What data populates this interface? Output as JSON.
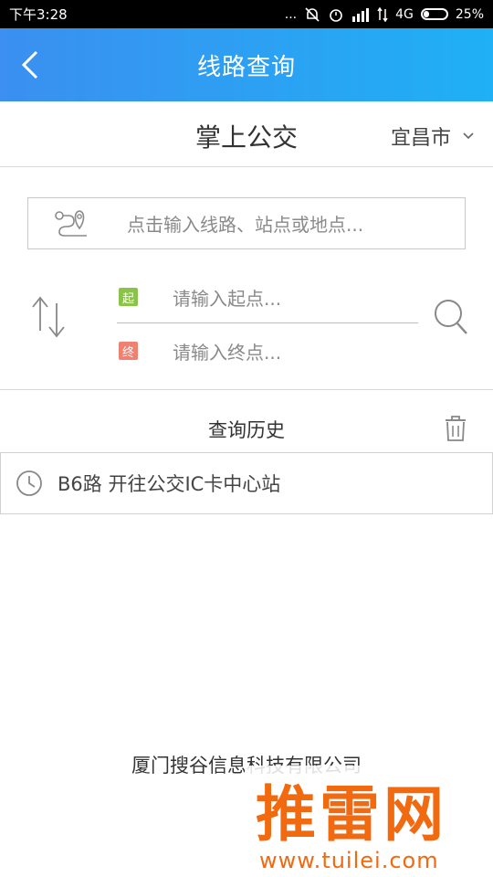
{
  "status_bar": {
    "time": "下午3:28",
    "signal_dots": "...",
    "network": "4G",
    "battery": "25%",
    "battery_level": 0.25
  },
  "topbar": {
    "title": "线路查询"
  },
  "brand": {
    "title": "掌上公交",
    "city": "宜昌市"
  },
  "search": {
    "placeholder": "点击输入线路、站点或地点..."
  },
  "route_form": {
    "start_tag": "起",
    "start_placeholder": "请输入起点...",
    "end_tag": "终",
    "end_placeholder": "请输入终点...",
    "start_color": "#8bc34a",
    "end_color": "#f08070"
  },
  "history": {
    "title": "查询历史",
    "items": [
      {
        "text": "B6路 开往公交IC卡中心站"
      }
    ]
  },
  "footer": {
    "company": "厦门搜谷信息科技有限公司"
  },
  "watermark": {
    "main": "推雷网",
    "url": "www.tuilei.com"
  },
  "colors": {
    "accent": "#2f9cf2",
    "watermark": "#f26a0f"
  }
}
